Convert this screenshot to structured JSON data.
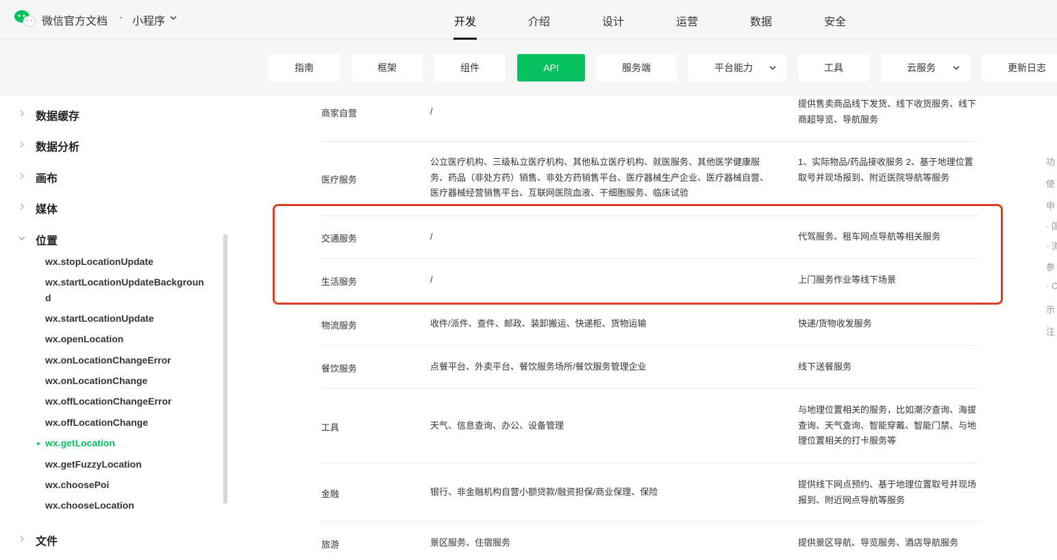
{
  "header": {
    "brand": "微信官方文档",
    "separator": "·",
    "product": "小程序",
    "nav": [
      "开发",
      "介绍",
      "设计",
      "运营",
      "数据",
      "安全"
    ]
  },
  "subtabs": [
    "指南",
    "框架",
    "组件",
    "API",
    "服务端",
    "平台能力",
    "工具",
    "云服务",
    "更新日志"
  ],
  "sidebar": {
    "categories": [
      "数据缓存",
      "数据分析",
      "画布",
      "媒体",
      "位置",
      "文件"
    ],
    "location_items": [
      "wx.stopLocationUpdate",
      "wx.startLocationUpdateBackground",
      "wx.startLocationUpdate",
      "wx.openLocation",
      "wx.onLocationChangeError",
      "wx.onLocationChange",
      "wx.offLocationChangeError",
      "wx.offLocationChange",
      "wx.getLocation",
      "wx.getFuzzyLocation",
      "wx.choosePoi",
      "wx.chooseLocation"
    ]
  },
  "table": {
    "rows": [
      {
        "category": "商家自营",
        "scope": "/",
        "scene": "提供售卖商品线下发货、线下收货服务、线下商超导览、导航服务"
      },
      {
        "category": "医疗服务",
        "scope": "公立医疗机构、三级私立医疗机构、其他私立医疗机构、就医服务、其他医学健康服务、药品（非处方药）销售、非处方药销售平台、医疗器械生产企业、医疗器械自营、医疗器械经营销售平台、互联网医院血液、干细胞服务、临床试验",
        "scene": "1、实际物品/药品接收服务 2、基于地理位置取号并现场报到、附近医院导航等服务"
      },
      {
        "category": "交通服务",
        "scope": "/",
        "scene": "代驾服务、租车网点导航等相关服务"
      },
      {
        "category": "生活服务",
        "scope": "/",
        "scene": "上门服务作业等线下场景"
      },
      {
        "category": "物流服务",
        "scope": "收件/派件、查件、邮政、装卸搬运、快递柜、货物运输",
        "scene": "快递/货物收发服务"
      },
      {
        "category": "餐饮服务",
        "scope": "点餐平台、外卖平台、餐饮服务场所/餐饮服务管理企业",
        "scene": "线下送餐服务"
      },
      {
        "category": "工具",
        "scope": "天气、信息查询、办公、设备管理",
        "scene": "与地理位置相关的服务，比如潮汐查询、海拔查询、天气查询、智能穿戴、智能门禁、与地理位置相关的打卡服务等"
      },
      {
        "category": "金融",
        "scope": "银行、非金融机构自营小额贷款/融资担保/商业保理、保险",
        "scene": "提供线下网点预约、基于地理位置取号并现场报到、附近网点导航等服务"
      },
      {
        "category": "旅游",
        "scope": "景区服务、住宿服务",
        "scene": "提供景区导航、导览服务、酒店导航服务"
      }
    ]
  },
  "toc": [
    "功",
    "使",
    "申",
    "· 国",
    "· 浏",
    "参",
    "· C",
    "示",
    "注"
  ],
  "colors": {
    "accent": "#07c160",
    "highlight": "#d84025"
  }
}
